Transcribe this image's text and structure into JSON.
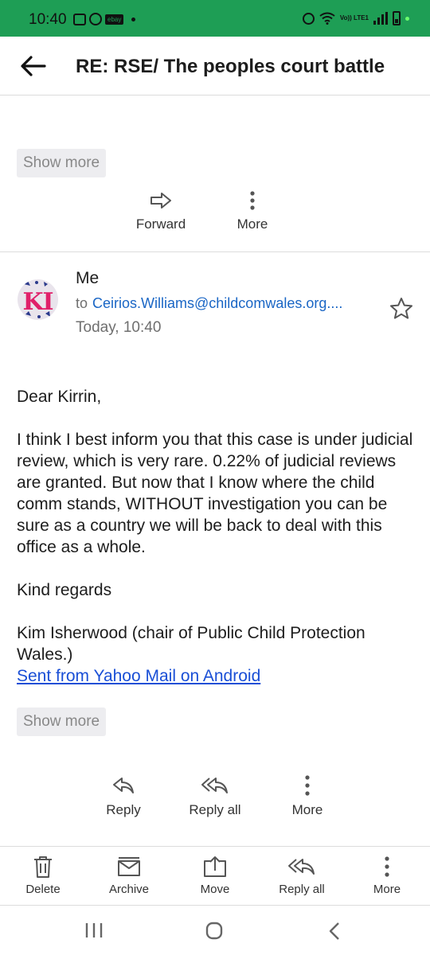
{
  "status_bar": {
    "time": "10:40",
    "ebay_label": "ebay",
    "lte_label": "Vo)) LTE1"
  },
  "header": {
    "title": "RE: RSE/ The peoples court battle"
  },
  "previous_message": {
    "show_more_label": "Show more",
    "actions": {
      "forward_label": "Forward",
      "more_label": "More"
    }
  },
  "message": {
    "avatar_initials": "KI",
    "sender": "Me",
    "to_prefix": "to",
    "recipient": "Ceirios.Williams@childcomwales.org....",
    "date": "Today, 10:40",
    "body": {
      "greeting": "Dear Kirrin,",
      "paragraph": "I think I best inform you that this case is under judicial review, which is very rare. 0.22% of judicial reviews are granted. But now that I know where the child comm stands, WITHOUT investigation you can be sure as a country we will be back to deal with this office as a whole.",
      "closing": "Kind regards",
      "signature": "Kim Isherwood (chair of Public Child Protection Wales.)",
      "sent_from": "Sent from Yahoo Mail on Android"
    },
    "show_more_label": "Show more",
    "actions": {
      "reply_label": "Reply",
      "reply_all_label": "Reply all",
      "more_label": "More"
    }
  },
  "bottom_bar": {
    "delete_label": "Delete",
    "archive_label": "Archive",
    "move_label": "Move",
    "reply_all_label": "Reply all",
    "more_label": "More"
  },
  "colors": {
    "status_bar": "#1e9e55",
    "link": "#1a66c5",
    "avatar_text": "#e0206a"
  }
}
